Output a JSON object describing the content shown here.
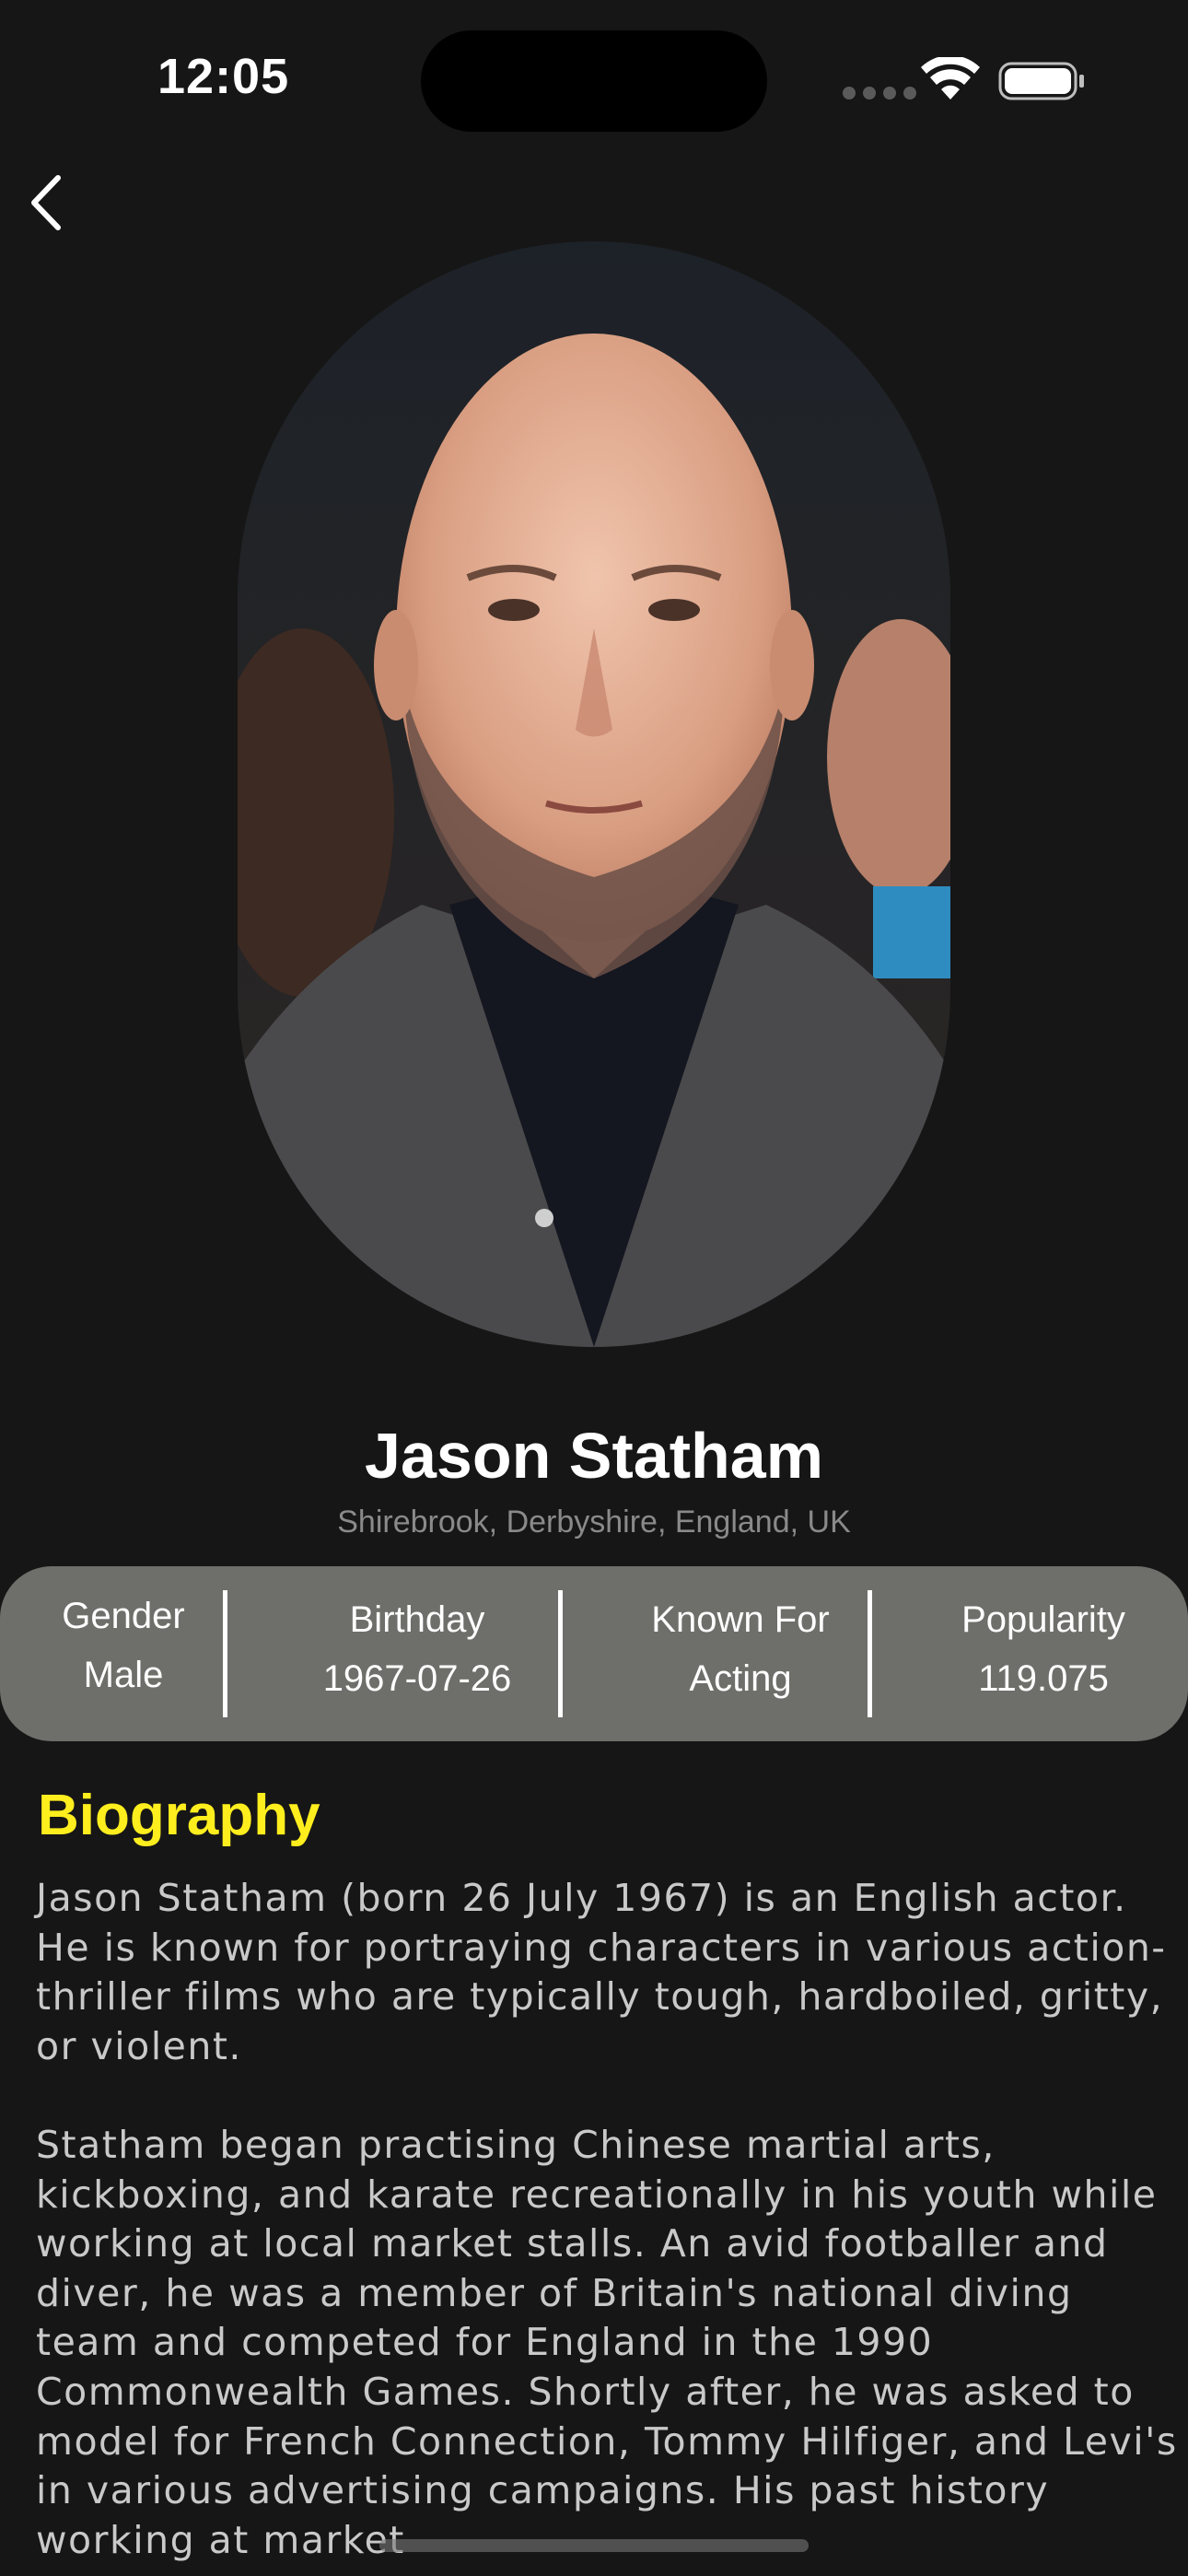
{
  "status_bar": {
    "time": "12:05"
  },
  "navigation": {
    "back_icon": "chevron-left-icon"
  },
  "profile": {
    "name": "Jason Statham",
    "birthplace": "Shirebrook, Derbyshire, England, UK",
    "photo_icon": "person-portrait-image"
  },
  "stats": [
    {
      "label": "Gender",
      "value": "Male"
    },
    {
      "label": "Birthday",
      "value": "1967-07-26"
    },
    {
      "label": "Known For",
      "value": "Acting"
    },
    {
      "label": "Popularity",
      "value": "119.075"
    }
  ],
  "biography": {
    "heading": "Biography",
    "text": "Jason Statham (born 26 July 1967) is an English actor. He is known for portraying characters in various action-thriller films who are typically tough, hardboiled, gritty, or violent.\n\nStatham began practising Chinese martial arts, kickboxing, and karate recreationally in his youth while working at local market stalls. An avid footballer and diver, he was a member of Britain's national diving team and competed for England in the 1990 Commonwealth Games. Shortly after, he was asked to model for French Connection, Tommy Hilfiger, and Levi's in various advertising campaigns. His past history working at market"
  },
  "colors": {
    "background": "#161616",
    "stats_bar": "#6e6e6a",
    "accent_heading": "#ffee1e",
    "secondary_text": "#8a8a8a",
    "body_text": "#c9c9c9"
  }
}
